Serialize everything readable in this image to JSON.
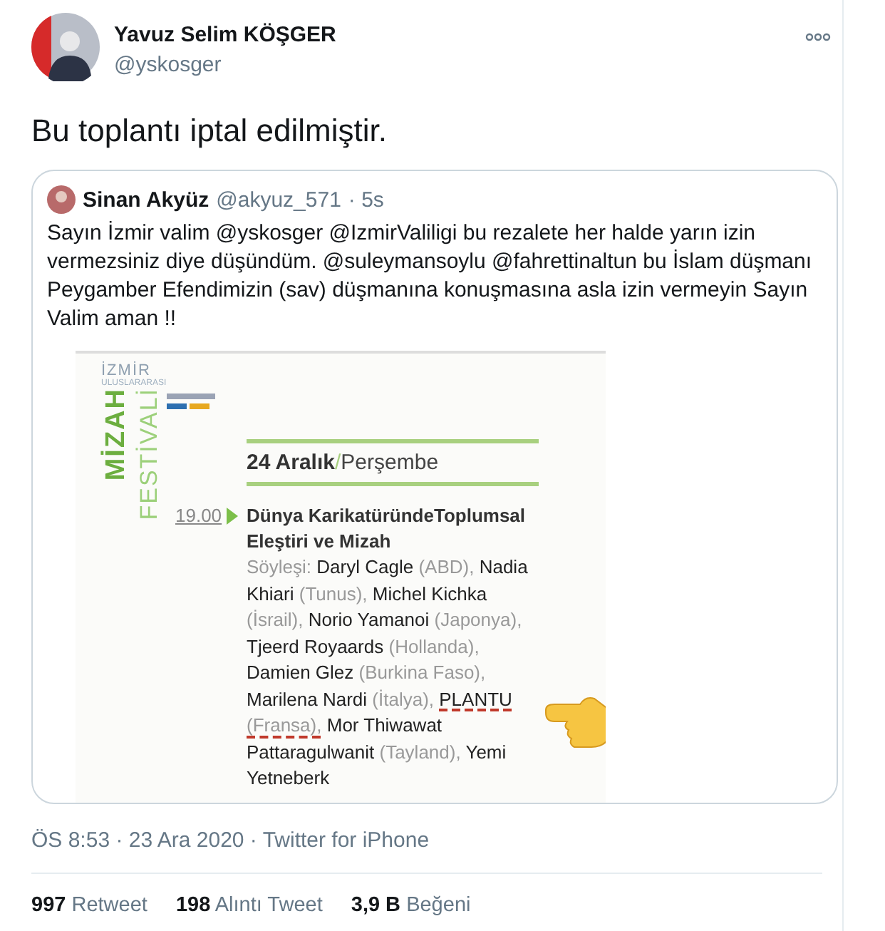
{
  "tweet": {
    "author": "Yavuz Selim KÖŞGER",
    "handle": "@yskosger",
    "text": "Bu toplantı iptal edilmiştir.",
    "quote": {
      "author": "Sinan Akyüz",
      "handle": "@akyuz_571",
      "age": "· 5s",
      "text": "Sayın İzmir valim @yskosger @IzmirValiligi bu rezalete her halde yarın izin vermezsiniz diye düşündüm. @suleymansoylu @fahrettinaltun bu İslam düşmanı Peygamber Efendimizin (sav) düşmanına konuşmasına asla izin vermeyin Sayın Valim aman !!",
      "document": {
        "logo": {
          "city": "İZMİR",
          "subtitle": "ULUSLARARASI",
          "word1": "MİZAH",
          "word2": "FESTİVALİ"
        },
        "date": "24 Aralık",
        "separator": "/",
        "weekday": "Perşembe",
        "time": "19.00",
        "title": "Dünya KarikatüründeToplumsal Eleştiri ve Mizah",
        "intro": "Söyleşi:",
        "speakers": [
          {
            "name": "Daryl Cagle",
            "country": "(ABD),",
            "underlined": false
          },
          {
            "name": "Nadia Khiari",
            "country": "(Tunus),",
            "underlined": false
          },
          {
            "name": "Michel Kichka",
            "country": "(İsrail),",
            "underlined": false
          },
          {
            "name": "Norio Yamanoi",
            "country": "(Japonya),",
            "underlined": false
          },
          {
            "name": "Tjeerd Royaards",
            "country": "(Hollanda),",
            "underlined": false
          },
          {
            "name": "Damien Glez",
            "country": "(Burkina Faso),",
            "underlined": false
          },
          {
            "name": "Marilena Nardi",
            "country": "(İtalya),",
            "underlined": false
          },
          {
            "name": "PLANTU",
            "country": "(Fransa),",
            "underlined": true
          },
          {
            "name": "Mor Thiwawat Pattaragulwanit",
            "country": "(Tayland),",
            "underlined": false
          },
          {
            "name": "Yemi Yetneberk",
            "underlined": false
          }
        ]
      }
    },
    "meta": "ÖS 8:53 · 23 Ara 2020 · Twitter for iPhone",
    "stats": [
      {
        "count": "997",
        "label": "Retweet"
      },
      {
        "count": "198",
        "label": "Alıntı Tweet"
      },
      {
        "count": "3,9 B",
        "label": "Beğeni"
      }
    ]
  }
}
